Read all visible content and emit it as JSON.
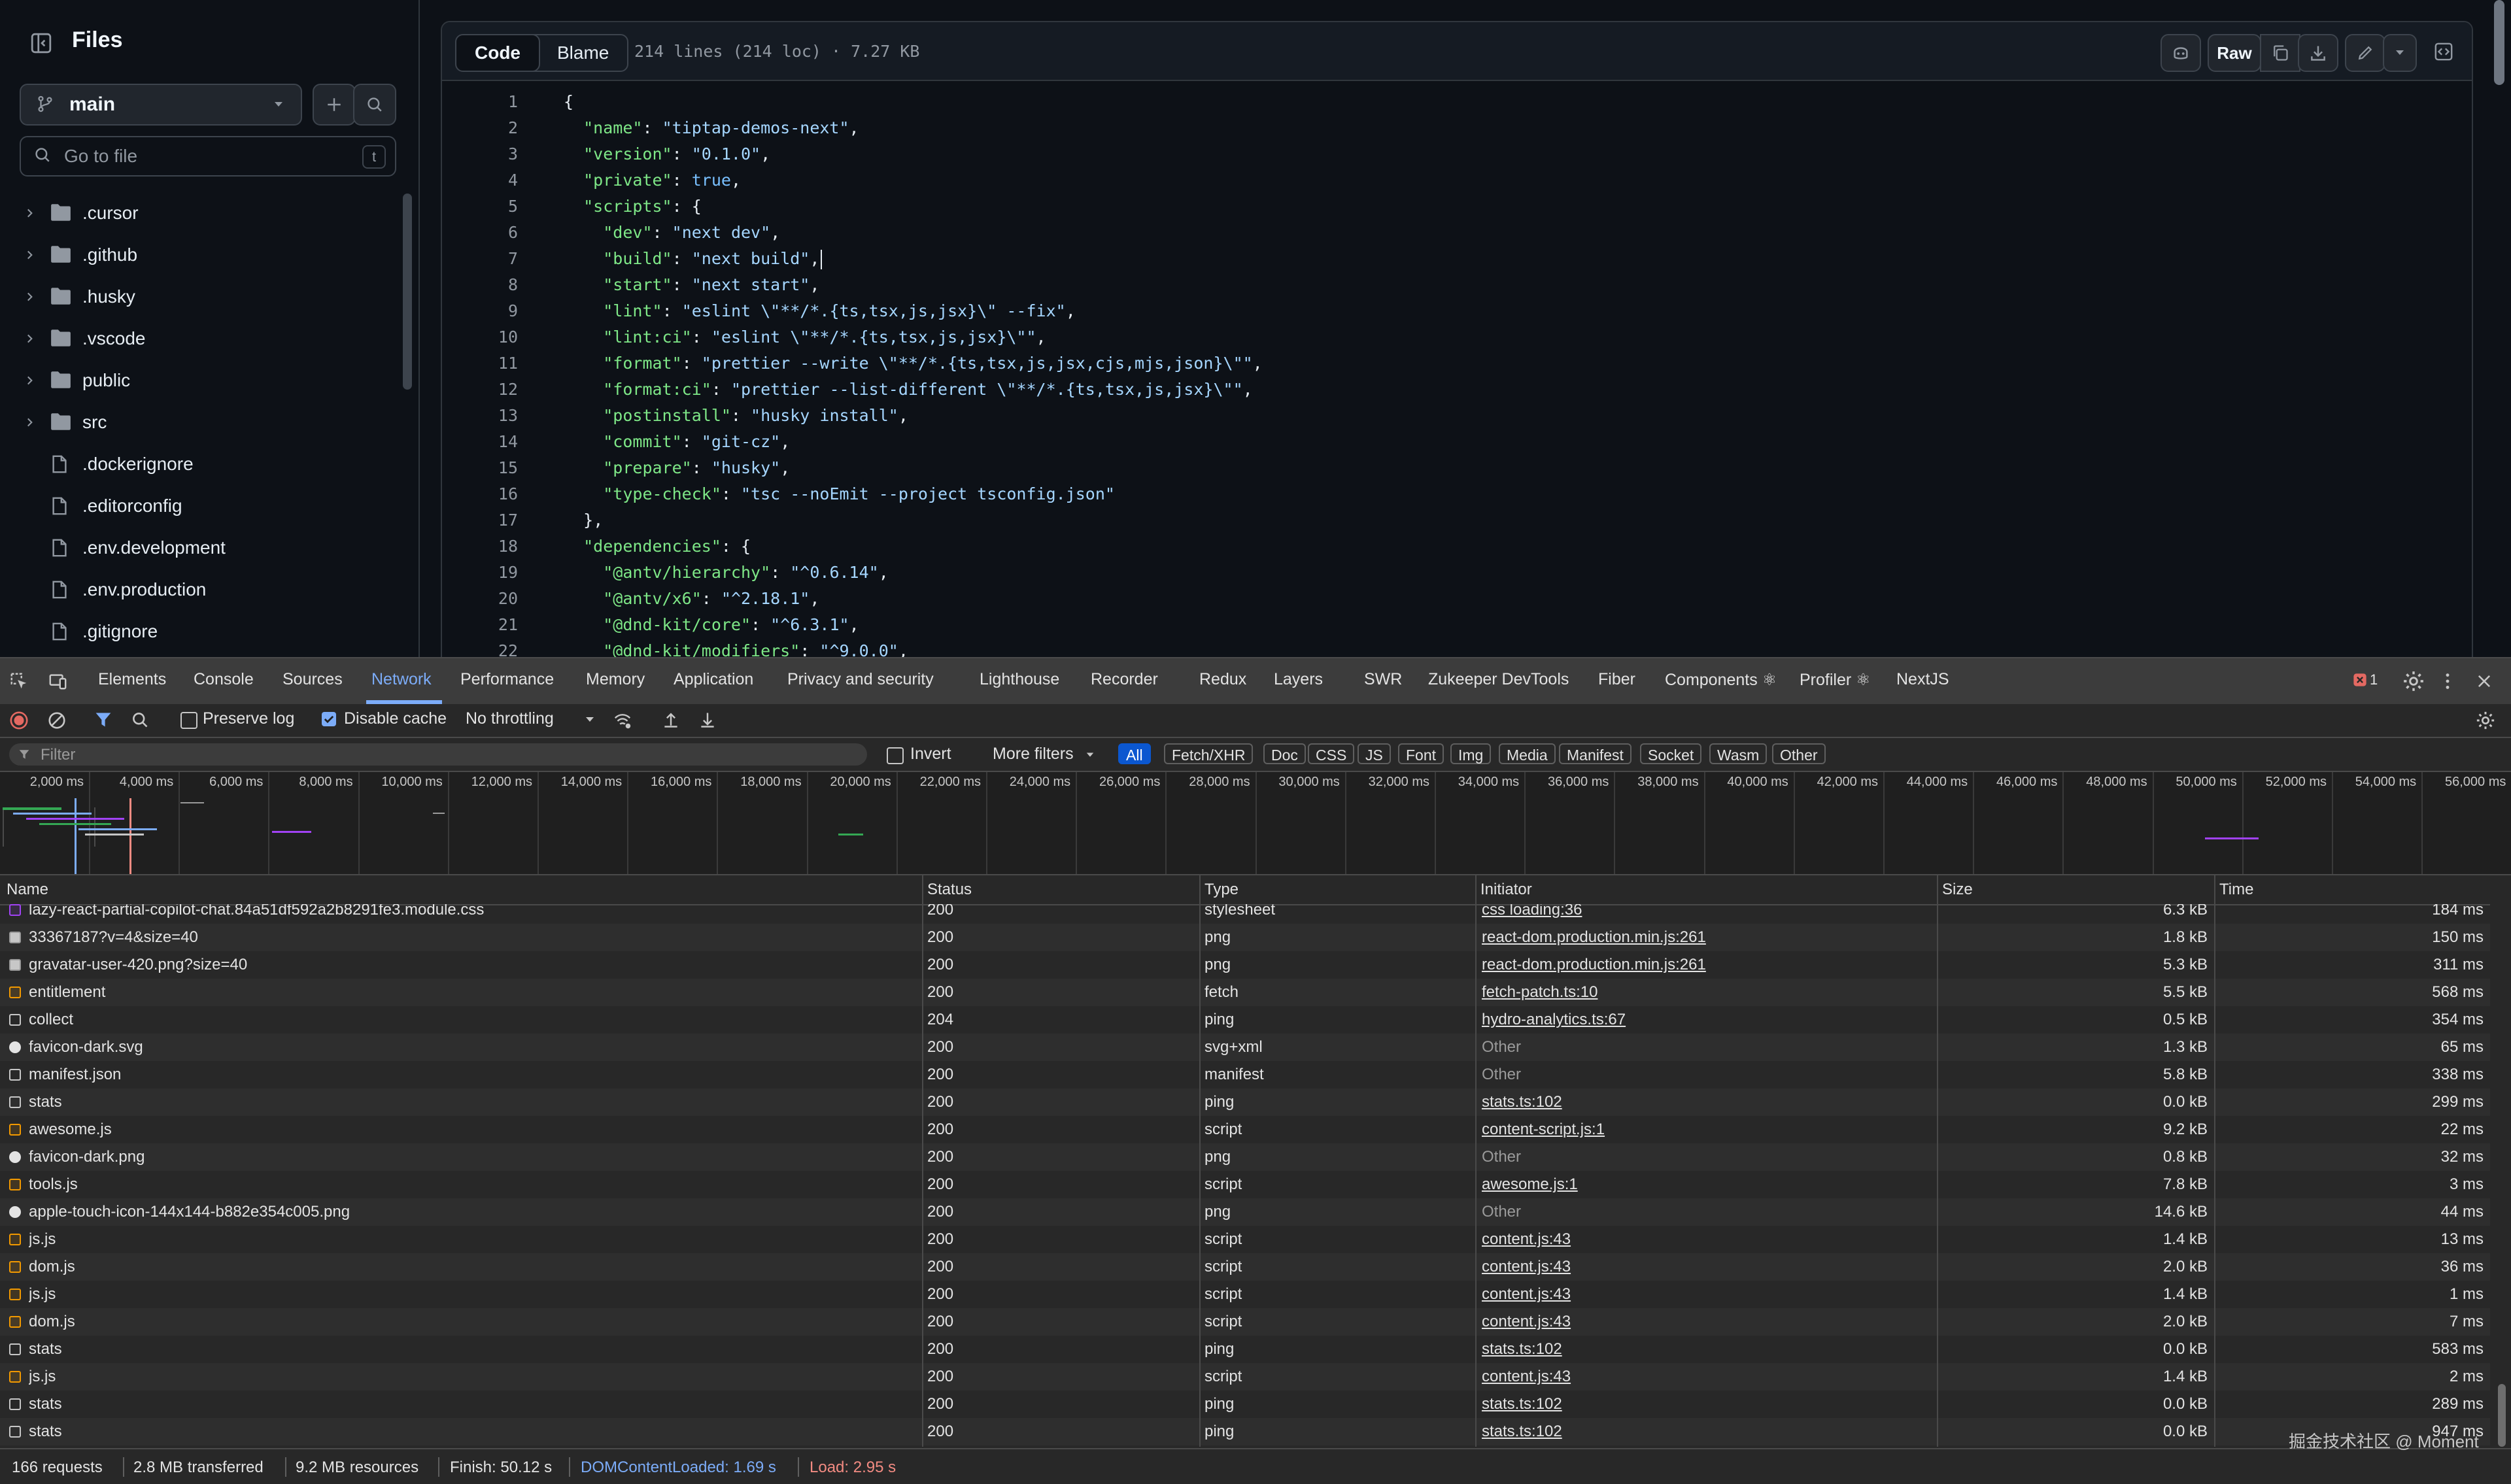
{
  "sidebar": {
    "title": "Files",
    "branch": "main",
    "search_placeholder": "Go to file",
    "search_shortcut": "t",
    "items": [
      {
        "label": ".cursor",
        "type": "folder"
      },
      {
        "label": ".github",
        "type": "folder"
      },
      {
        "label": ".husky",
        "type": "folder"
      },
      {
        "label": ".vscode",
        "type": "folder"
      },
      {
        "label": "public",
        "type": "folder"
      },
      {
        "label": "src",
        "type": "folder"
      },
      {
        "label": ".dockerignore",
        "type": "file"
      },
      {
        "label": ".editorconfig",
        "type": "file"
      },
      {
        "label": ".env.development",
        "type": "file"
      },
      {
        "label": ".env.production",
        "type": "file"
      },
      {
        "label": ".gitignore",
        "type": "file"
      }
    ]
  },
  "code": {
    "tabs": [
      "Code",
      "Blame"
    ],
    "active_tab": "Code",
    "file_info": "214 lines (214 loc) · 7.27 KB",
    "raw_label": "Raw",
    "lines": [
      "{",
      "  \"name\": \"tiptap-demos-next\",",
      "  \"version\": \"0.1.0\",",
      "  \"private\": true,",
      "  \"scripts\": {",
      "    \"dev\": \"next dev\",",
      "    \"build\": \"next build\",",
      "    \"start\": \"next start\",",
      "    \"lint\": \"eslint \\\"**/*.{ts,tsx,js,jsx}\\\" --fix\",",
      "    \"lint:ci\": \"eslint \\\"**/*.{ts,tsx,js,jsx}\\\"\",",
      "    \"format\": \"prettier --write \\\"**/*.{ts,tsx,js,jsx,cjs,mjs,json}\\\"\",",
      "    \"format:ci\": \"prettier --list-different \\\"**/*.{ts,tsx,js,jsx}\\\"\",",
      "    \"postinstall\": \"husky install\",",
      "    \"commit\": \"git-cz\",",
      "    \"prepare\": \"husky\",",
      "    \"type-check\": \"tsc --noEmit --project tsconfig.json\"",
      "  },",
      "  \"dependencies\": {",
      "    \"@antv/hierarchy\": \"^0.6.14\",",
      "    \"@antv/x6\": \"^2.18.1\",",
      "    \"@dnd-kit/core\": \"^6.3.1\",",
      "    \"@dnd-kit/modifiers\": \"^9.0.0\","
    ]
  },
  "devtools": {
    "tabs": [
      "Elements",
      "Console",
      "Sources",
      "Network",
      "Performance",
      "Memory",
      "Application",
      "Privacy and security",
      "Lighthouse",
      "Recorder",
      "Redux",
      "Layers",
      "SWR",
      "Zukeeper DevTools",
      "Fiber",
      "Components ⚛",
      "Profiler ⚛",
      "NextJS"
    ],
    "active_tab": "Network",
    "error_count": "1",
    "toolbar": {
      "preserve_log": "Preserve log",
      "disable_cache": "Disable cache",
      "throttling": "No throttling"
    },
    "filter": {
      "placeholder": "Filter",
      "invert": "Invert",
      "more_filters": "More filters",
      "types": [
        "All",
        "Fetch/XHR",
        "Doc",
        "CSS",
        "JS",
        "Font",
        "Img",
        "Media",
        "Manifest",
        "Socket",
        "Wasm",
        "Other"
      ],
      "active_type": "All"
    },
    "timeline_ticks": [
      "2,000 ms",
      "4,000 ms",
      "6,000 ms",
      "8,000 ms",
      "10,000 ms",
      "12,000 ms",
      "14,000 ms",
      "16,000 ms",
      "18,000 ms",
      "20,000 ms",
      "22,000 ms",
      "24,000 ms",
      "26,000 ms",
      "28,000 ms",
      "30,000 ms",
      "32,000 ms",
      "34,000 ms",
      "36,000 ms",
      "38,000 ms",
      "40,000 ms",
      "42,000 ms",
      "44,000 ms",
      "46,000 ms",
      "48,000 ms",
      "50,000 ms",
      "52,000 ms",
      "54,000 ms",
      "56,000 ms"
    ],
    "columns": [
      "Name",
      "Status",
      "Type",
      "Initiator",
      "Size",
      "Time"
    ],
    "rows": [
      {
        "name": "lazy-react-partial-copilot-chat.84a51df592a2b8291fe3.module.css",
        "status": "200",
        "type": "stylesheet",
        "initiator": "css loading:36",
        "size": "6.3 kB",
        "time": "184 ms",
        "icon": "css",
        "link": true
      },
      {
        "name": "33367187?v=4&size=40",
        "status": "200",
        "type": "png",
        "initiator": "react-dom.production.min.js:261",
        "size": "1.8 kB",
        "time": "150 ms",
        "icon": "img",
        "link": true
      },
      {
        "name": "gravatar-user-420.png?size=40",
        "status": "200",
        "type": "png",
        "initiator": "react-dom.production.min.js:261",
        "size": "5.3 kB",
        "time": "311 ms",
        "icon": "img",
        "link": true
      },
      {
        "name": "entitlement",
        "status": "200",
        "type": "fetch",
        "initiator": "fetch-patch.ts:10",
        "size": "5.5 kB",
        "time": "568 ms",
        "icon": "fetch",
        "link": true
      },
      {
        "name": "collect",
        "status": "204",
        "type": "ping",
        "initiator": "hydro-analytics.ts:67",
        "size": "0.5 kB",
        "time": "354 ms",
        "icon": "other",
        "link": true
      },
      {
        "name": "favicon-dark.svg",
        "status": "200",
        "type": "svg+xml",
        "initiator": "Other",
        "size": "1.3 kB",
        "time": "65 ms",
        "icon": "gh",
        "link": false
      },
      {
        "name": "manifest.json",
        "status": "200",
        "type": "manifest",
        "initiator": "Other",
        "size": "5.8 kB",
        "time": "338 ms",
        "icon": "doc",
        "link": false
      },
      {
        "name": "stats",
        "status": "200",
        "type": "ping",
        "initiator": "stats.ts:102",
        "size": "0.0 kB",
        "time": "299 ms",
        "icon": "other",
        "link": true
      },
      {
        "name": "awesome.js",
        "status": "200",
        "type": "script",
        "initiator": "content-script.js:1",
        "size": "9.2 kB",
        "time": "22 ms",
        "icon": "js",
        "link": true
      },
      {
        "name": "favicon-dark.png",
        "status": "200",
        "type": "png",
        "initiator": "Other",
        "size": "0.8 kB",
        "time": "32 ms",
        "icon": "gh",
        "link": false
      },
      {
        "name": "tools.js",
        "status": "200",
        "type": "script",
        "initiator": "awesome.js:1",
        "size": "7.8 kB",
        "time": "3 ms",
        "icon": "js",
        "link": true
      },
      {
        "name": "apple-touch-icon-144x144-b882e354c005.png",
        "status": "200",
        "type": "png",
        "initiator": "Other",
        "size": "14.6 kB",
        "time": "44 ms",
        "icon": "gh",
        "link": false
      },
      {
        "name": "js.js",
        "status": "200",
        "type": "script",
        "initiator": "content.js:43",
        "size": "1.4 kB",
        "time": "13 ms",
        "icon": "js",
        "link": true
      },
      {
        "name": "dom.js",
        "status": "200",
        "type": "script",
        "initiator": "content.js:43",
        "size": "2.0 kB",
        "time": "36 ms",
        "icon": "js",
        "link": true
      },
      {
        "name": "js.js",
        "status": "200",
        "type": "script",
        "initiator": "content.js:43",
        "size": "1.4 kB",
        "time": "1 ms",
        "icon": "js",
        "link": true
      },
      {
        "name": "dom.js",
        "status": "200",
        "type": "script",
        "initiator": "content.js:43",
        "size": "2.0 kB",
        "time": "7 ms",
        "icon": "js",
        "link": true
      },
      {
        "name": "stats",
        "status": "200",
        "type": "ping",
        "initiator": "stats.ts:102",
        "size": "0.0 kB",
        "time": "583 ms",
        "icon": "other",
        "link": true
      },
      {
        "name": "js.js",
        "status": "200",
        "type": "script",
        "initiator": "content.js:43",
        "size": "1.4 kB",
        "time": "2 ms",
        "icon": "js",
        "link": true
      },
      {
        "name": "stats",
        "status": "200",
        "type": "ping",
        "initiator": "stats.ts:102",
        "size": "0.0 kB",
        "time": "289 ms",
        "icon": "other",
        "link": true
      },
      {
        "name": "stats",
        "status": "200",
        "type": "ping",
        "initiator": "stats.ts:102",
        "size": "0.0 kB",
        "time": "947 ms",
        "icon": "other",
        "link": true
      }
    ],
    "status": {
      "requests": "166 requests",
      "transferred": "2.8 MB transferred",
      "resources": "9.2 MB resources",
      "finish": "Finish: 50.12 s",
      "dom_loaded": "DOMContentLoaded: 1.69 s",
      "load": "Load: 2.95 s"
    },
    "watermark": "掘金技术社区 @ Moment"
  },
  "colors": {
    "active_tab": "#7cacf8",
    "dom_loaded": "#7cacf8",
    "load": "#f28b82",
    "error": "#e46962"
  }
}
